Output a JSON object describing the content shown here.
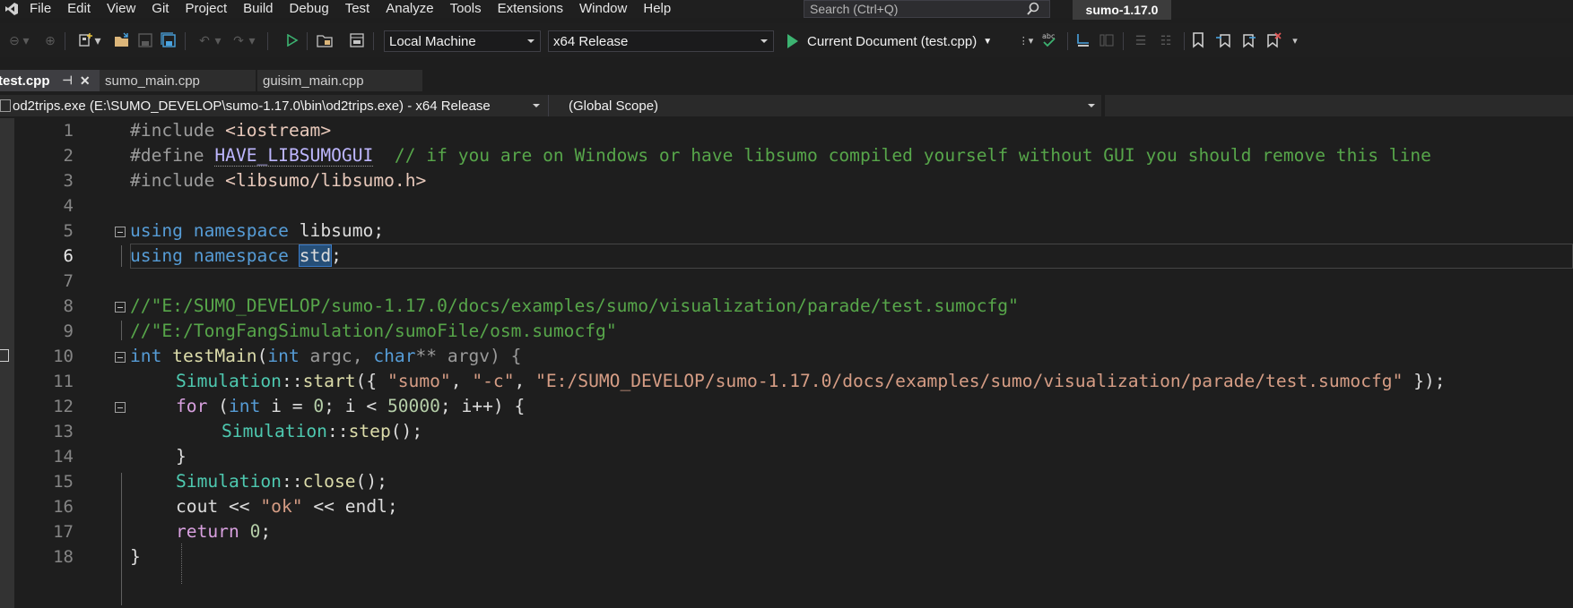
{
  "menu": {
    "items": [
      "File",
      "Edit",
      "View",
      "Git",
      "Project",
      "Build",
      "Debug",
      "Test",
      "Analyze",
      "Tools",
      "Extensions",
      "Window",
      "Help"
    ],
    "search_placeholder": "Search (Ctrl+Q)",
    "solution_name": "sumo-1.17.0"
  },
  "toolbar": {
    "debug_target": "Local Machine",
    "configuration": "x64 Release",
    "run_label": "Current Document (test.cpp)"
  },
  "tabs": [
    {
      "label": "test.cpp",
      "active": true
    },
    {
      "label": "sumo_main.cpp",
      "active": false
    },
    {
      "label": "guisim_main.cpp",
      "active": false
    }
  ],
  "navbar": {
    "project": "od2trips.exe (E:\\SUMO_DEVELOP\\sumo-1.17.0\\bin\\od2trips.exe) - x64 Release",
    "scope": "(Global Scope)"
  },
  "editor": {
    "current_line": 6,
    "lines": [
      {
        "n": "1"
      },
      {
        "n": "2"
      },
      {
        "n": "3"
      },
      {
        "n": "4"
      },
      {
        "n": "5"
      },
      {
        "n": "6"
      },
      {
        "n": "7"
      },
      {
        "n": "8"
      },
      {
        "n": "9"
      },
      {
        "n": "10"
      },
      {
        "n": "11"
      },
      {
        "n": "12"
      },
      {
        "n": "13"
      },
      {
        "n": "14"
      },
      {
        "n": "15"
      },
      {
        "n": "16"
      },
      {
        "n": "17"
      },
      {
        "n": "18"
      }
    ],
    "tokens": {
      "l1_pp": "#include ",
      "l1_inc": "<iostream>",
      "l2_pp": "#define ",
      "l2_macro": "HAVE_LIBSUMOGUI",
      "l2_cm": "  // if you are on Windows or have libsumo compiled yourself without GUI you should remove this line",
      "l3_pp": "#include ",
      "l3_inc": "<libsumo/libsumo.h>",
      "l5_kw": "using namespace",
      "l5_rest": " libsumo;",
      "l6_kw": "using namespace",
      "l6_sp": " ",
      "l6_sel": "std",
      "l6_end": ";",
      "l8_cm": "//\"E:/SUMO_DEVELOP/sumo-1.17.0/docs/examples/sumo/visualization/parade/test.sumocfg\"",
      "l9_cm": "//\"E:/TongFangSimulation/sumoFile/osm.sumocfg\"",
      "l10_kw1": "int",
      "l10_fn": " testMain",
      "l10_p1": "(",
      "l10_kw2": "int",
      "l10_a1": " argc, ",
      "l10_kw3": "char",
      "l10_a2": "** argv) {",
      "l11_ns": "Simulation",
      "l11_sep": "::",
      "l11_fn": "start",
      "l11_p1": "({ ",
      "l11_s1": "\"sumo\"",
      "l11_c1": ", ",
      "l11_s2": "\"-c\"",
      "l11_c2": ", ",
      "l11_s3": "\"E:/SUMO_DEVELOP/sumo-1.17.0/docs/examples/sumo/visualization/parade/test.sumocfg\"",
      "l11_end": " });",
      "l12_ctl": "for",
      "l12_p1": " (",
      "l12_kw": "int",
      "l12_v1": " i = ",
      "l12_n1": "0",
      "l12_v2": "; i < ",
      "l12_n2": "50000",
      "l12_v3": "; i++) {",
      "l13_ns": "Simulation",
      "l13_sep": "::",
      "l13_fn": "step",
      "l13_end": "();",
      "l14": "}",
      "l15_ns": "Simulation",
      "l15_sep": "::",
      "l15_fn": "close",
      "l15_end": "();",
      "l16_a": "cout << ",
      "l16_s": "\"ok\"",
      "l16_b": " << endl;",
      "l17_ctl": "return",
      "l17_sp": " ",
      "l17_n": "0",
      "l17_end": ";",
      "l18": "}"
    }
  }
}
